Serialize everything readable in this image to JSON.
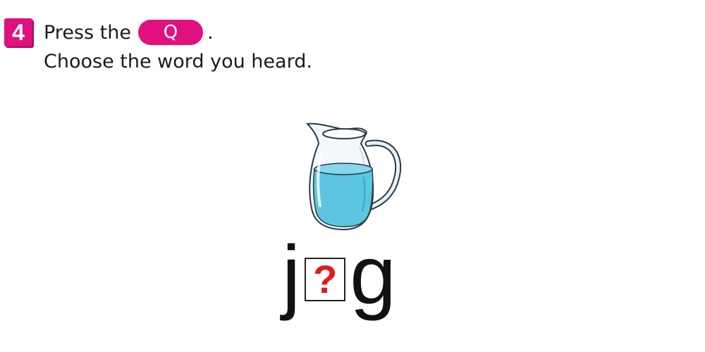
{
  "step": {
    "number": "4",
    "color": "#e0117f"
  },
  "instruction": {
    "line1_prefix": "Press the",
    "button_label": "Q",
    "line1_suffix": ".",
    "line2": "Choose the word you heard."
  },
  "picture": {
    "icon": "water-pitcher-icon",
    "water_color": "#5cc6e0"
  },
  "word": {
    "first_letter": "j",
    "blank_symbol": "?",
    "last_letter": "g",
    "blank_color": "#e21a1a"
  }
}
